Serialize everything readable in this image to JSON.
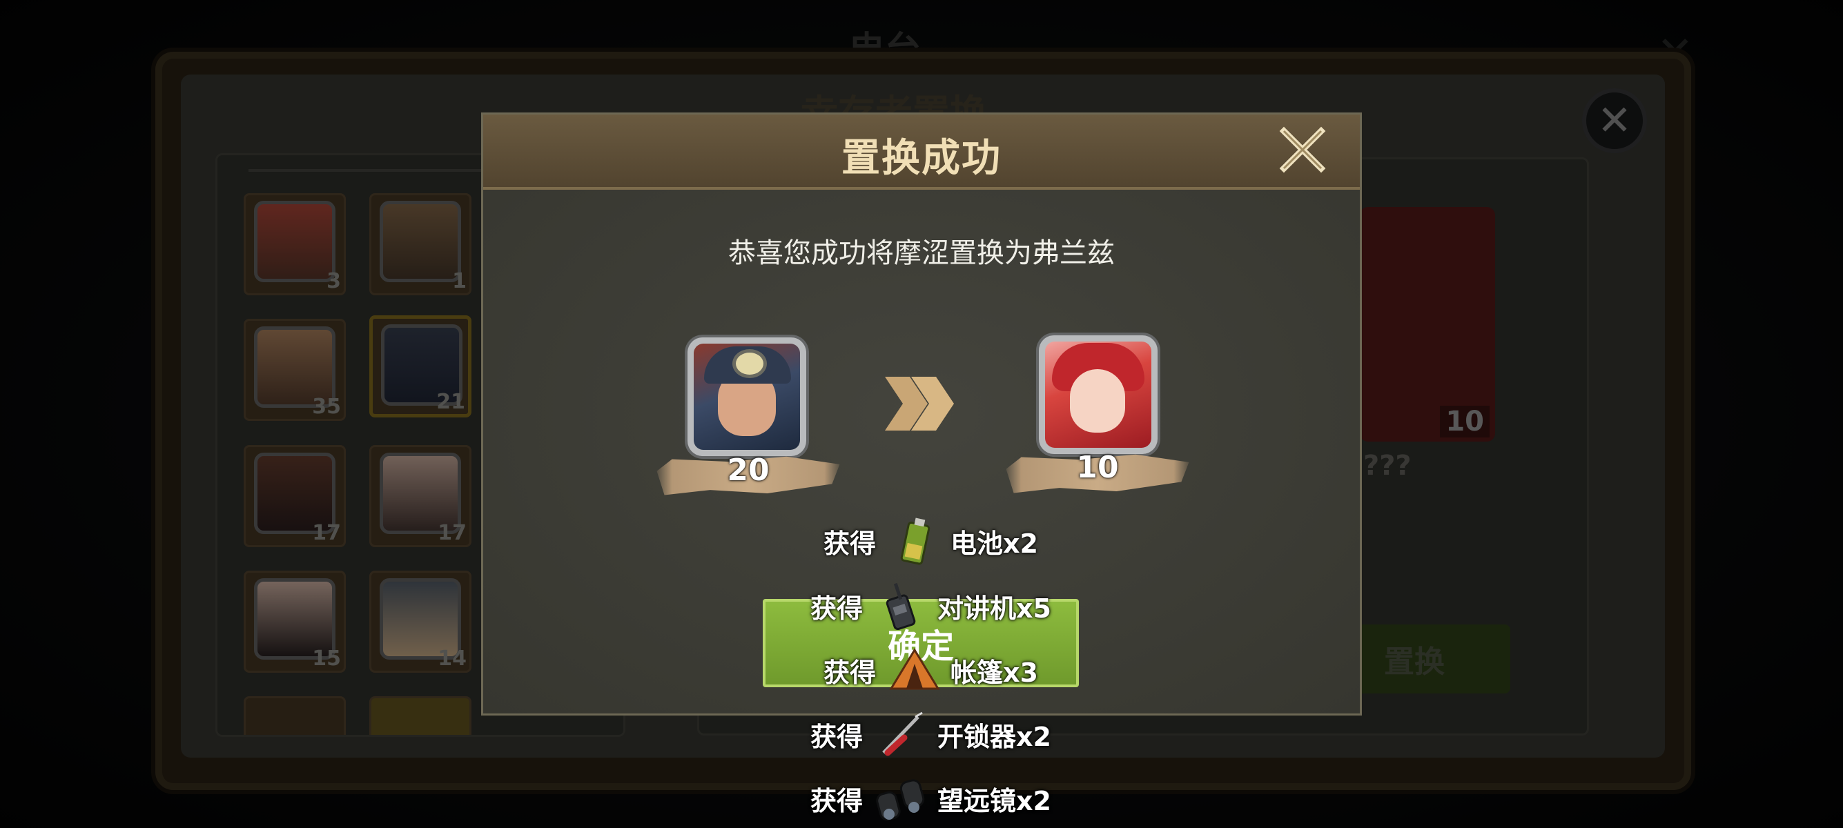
{
  "background": {
    "top_title": "电台",
    "panel_title": "幸存者置换",
    "hero_counts": [
      "3",
      "1",
      "35",
      "21",
      "17",
      "17",
      "15",
      "14"
    ],
    "target_count": "10",
    "target_name": "???",
    "action_label": "置换"
  },
  "modal": {
    "title": "置换成功",
    "message": "恭喜您成功将摩涩置换为弗兰兹",
    "from_hero": {
      "level": "20",
      "icon": "soldier-portrait-icon"
    },
    "to_hero": {
      "level": "10",
      "icon": "red-hair-girl-portrait-icon"
    },
    "confirm_label": "确定"
  },
  "rewards": [
    {
      "prefix": "获得",
      "icon": "battery-icon",
      "name": "电池x2"
    },
    {
      "prefix": "获得",
      "icon": "walkie-talkie-icon",
      "name": "对讲机x5"
    },
    {
      "prefix": "获得",
      "icon": "tent-icon",
      "name": "帐篷x3"
    },
    {
      "prefix": "获得",
      "icon": "lockpick-icon",
      "name": "开锁器x2"
    },
    {
      "prefix": "获得",
      "icon": "binoculars-icon",
      "name": "望远镜x2"
    }
  ],
  "colors": {
    "accent_title": "#f1dfb6",
    "confirm_green": "#7ea835",
    "banner_tan": "#c9ab86"
  }
}
